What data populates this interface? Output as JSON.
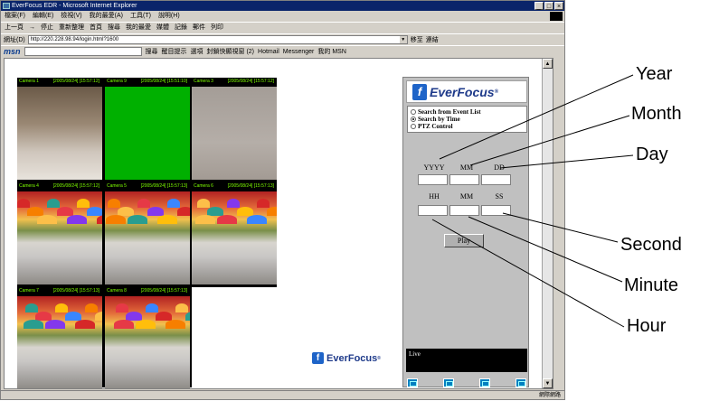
{
  "window": {
    "title": "EverFocus EDR - Microsoft Internet Explorer",
    "controls": [
      "_",
      "□",
      "×"
    ]
  },
  "menu": [
    "檔案(F)",
    "編輯(E)",
    "檢視(V)",
    "我的最愛(A)",
    "工具(T)",
    "說明(H)"
  ],
  "toolbar": [
    "上一頁",
    "→",
    "停止",
    "重新整理",
    "首頁",
    "搜尋",
    "我的最愛",
    "媒體",
    "記錄",
    "郵件",
    "列印"
  ],
  "address": {
    "label": "網址(D)",
    "url": "http://220.228.98.94/login.html?1600",
    "go": "移至",
    "links": "連結"
  },
  "msn": {
    "logo": "msn",
    "items": [
      "搜尋",
      "醒目提示",
      "選項",
      "封鎖快顯視窗 (2)",
      "Hotmail",
      "Messenger",
      "我的 MSN"
    ]
  },
  "cameras": [
    {
      "label": "Camera 1",
      "timestamp": "[2005/08/24] [15:57:12]",
      "scene": "room"
    },
    {
      "label": "Camera 9",
      "timestamp": "[2005/08/24] [15:51:10]",
      "scene": "green"
    },
    {
      "label": "Camera 3",
      "timestamp": "[2005/08/24] [15:57:12]",
      "scene": "grey"
    },
    {
      "label": "Camera 4",
      "timestamp": "[2005/08/24] [15:57:12]",
      "scene": "festival"
    },
    {
      "label": "Camera 5",
      "timestamp": "[2005/08/24] [15:57:13]",
      "scene": "festival"
    },
    {
      "label": "Camera 6",
      "timestamp": "[2005/08/24] [15:57:13]",
      "scene": "festival"
    },
    {
      "label": "Camera 7",
      "timestamp": "[2005/08/24] [15:57:13]",
      "scene": "festival"
    },
    {
      "label": "Camera 8",
      "timestamp": "[2005/08/24] [15:57:13]",
      "scene": "festival"
    }
  ],
  "logo_cell": {
    "brand": "EverFocus"
  },
  "panel": {
    "brand": "EverFocus",
    "modes": [
      {
        "label": "Search from Event List",
        "selected": false
      },
      {
        "label": "Search by Time",
        "selected": true
      },
      {
        "label": "PTZ Control",
        "selected": false
      }
    ],
    "date_headers": [
      "YYYY",
      "MM",
      "DD"
    ],
    "time_headers": [
      "HH",
      "MM",
      "SS"
    ],
    "play_label": "Play",
    "live_label": "Live",
    "layout_buttons": [
      "single-view",
      "quad-view",
      "nine-view",
      "full-view"
    ]
  },
  "status": {
    "left": "",
    "zone": "網際網路"
  },
  "callouts": {
    "year": "Year",
    "month": "Month",
    "day": "Day",
    "second": "Second",
    "minute": "Minute",
    "hour": "Hour"
  },
  "colors": {
    "titlebar": "#0a246a",
    "overlay_text": "#7fff00",
    "brand_blue": "#1e3a8a"
  }
}
